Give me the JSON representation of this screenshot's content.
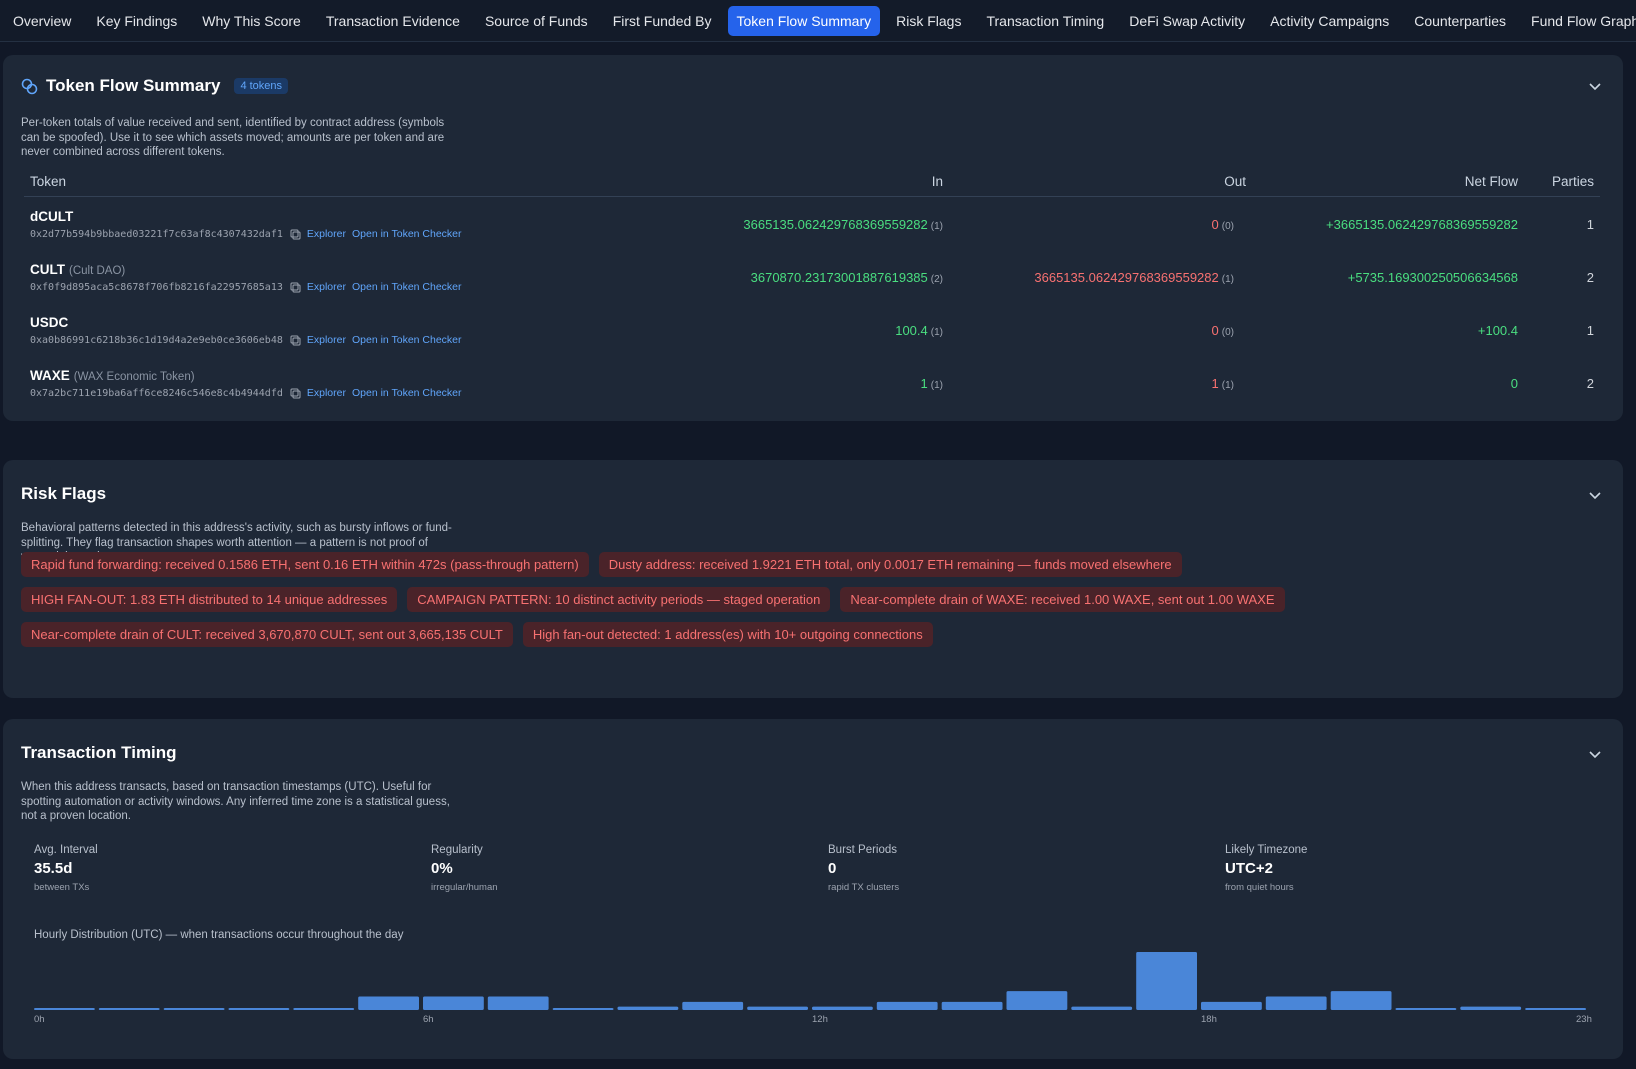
{
  "tabs": [
    {
      "label": "Overview",
      "active": false
    },
    {
      "label": "Key Findings",
      "active": false
    },
    {
      "label": "Why This Score",
      "active": false
    },
    {
      "label": "Transaction Evidence",
      "active": false
    },
    {
      "label": "Source of Funds",
      "active": false
    },
    {
      "label": "First Funded By",
      "active": false
    },
    {
      "label": "Token Flow Summary",
      "active": true
    },
    {
      "label": "Risk Flags",
      "active": false
    },
    {
      "label": "Transaction Timing",
      "active": false
    },
    {
      "label": "DeFi Swap Activity",
      "active": false
    },
    {
      "label": "Activity Campaigns",
      "active": false
    },
    {
      "label": "Counterparties",
      "active": false
    },
    {
      "label": "Fund Flow Graph",
      "active": false
    }
  ],
  "token_flow": {
    "title": "Token Flow Summary",
    "badge": "4 tokens",
    "description": "Per-token totals of value received and sent, identified by contract address (symbols can be spoofed). Use it to see which assets moved; amounts are per token and are never combined across different tokens.",
    "columns": {
      "token": "Token",
      "in": "In",
      "out": "Out",
      "net": "Net Flow",
      "parties": "Parties"
    },
    "explorer_label": "Explorer",
    "checker_label": "Open in Token Checker",
    "rows": [
      {
        "symbol": "dCULT",
        "name": "",
        "address": "0x2d77b594b9bbaed03221f7c63af8c4307432daf1",
        "in": "3665135.062429768369559282",
        "in_count": "(1)",
        "out": "0",
        "out_count": "(0)",
        "net": "+3665135.062429768369559282",
        "parties": "1"
      },
      {
        "symbol": "CULT",
        "name": "(Cult DAO)",
        "address": "0xf0f9d895aca5c8678f706fb8216fa22957685a13",
        "in": "3670870.23173001887619385",
        "in_count": "(2)",
        "out": "3665135.062429768369559282",
        "out_count": "(1)",
        "net": "+5735.16930025050663456‌8",
        "parties": "2"
      },
      {
        "symbol": "USDC",
        "name": "",
        "address": "0xa0b86991c6218b36c1d19d4a2e9eb0ce3606eb48",
        "in": "100.4",
        "in_count": "(1)",
        "out": "0",
        "out_count": "(0)",
        "net": "+100.4",
        "parties": "1"
      },
      {
        "symbol": "WAXE",
        "name": "(WAX Economic Token)",
        "address": "0x7a2bc711e19ba6aff6ce8246c546e8c4b4944dfd",
        "in": "1",
        "in_count": "(1)",
        "out": "1",
        "out_count": "(1)",
        "net": "0",
        "parties": "2"
      }
    ]
  },
  "risk_flags": {
    "title": "Risk Flags",
    "description": "Behavioral patterns detected in this address's activity, such as bursty inflows or fund-splitting. They flag transaction shapes worth attention — a pattern is not proof of wrongdoing or intent.",
    "rows": [
      [
        "Rapid fund forwarding: received 0.1586 ETH, sent 0.16 ETH within 472s (pass-through pattern)",
        "Dusty address: received 1.9221 ETH total, only 0.0017 ETH remaining — funds moved elsewhere"
      ],
      [
        "HIGH FAN-OUT: 1.83 ETH distributed to 14 unique addresses",
        "CAMPAIGN PATTERN: 10 distinct activity periods — staged operation",
        "Near-complete drain of WAXE: received 1.00 WAXE, sent out 1.00 WAXE"
      ],
      [
        "Near-complete drain of CULT: received 3,670,870 CULT, sent out 3,665,135 CULT",
        "High fan-out detected: 1 address(es) with 10+ outgoing connections"
      ]
    ]
  },
  "timing": {
    "title": "Transaction Timing",
    "description": "When this address transacts, based on transaction timestamps (UTC). Useful for spotting automation or activity windows. Any inferred time zone is a statistical guess, not a proven location.",
    "stats": [
      {
        "label": "Avg. Interval",
        "value": "35.5d",
        "sub": "between TXs"
      },
      {
        "label": "Regularity",
        "value": "0%",
        "sub": "irregular/human"
      },
      {
        "label": "Burst Periods",
        "value": "0",
        "sub": "rapid TX clusters"
      },
      {
        "label": "Likely Timezone",
        "value": "UTC+2",
        "sub": "from quiet hours"
      }
    ],
    "histogram_label": "Hourly Distribution (UTC) — when transactions occur throughout the day",
    "tick_labels": [
      "0h",
      "6h",
      "12h",
      "18h",
      "23h"
    ],
    "bar_color": "#4a86d8"
  },
  "chart_data": {
    "type": "bar",
    "categories": [
      "0",
      "1",
      "2",
      "3",
      "4",
      "5",
      "6",
      "7",
      "8",
      "9",
      "10",
      "11",
      "12",
      "13",
      "14",
      "15",
      "16",
      "17",
      "18",
      "19",
      "20",
      "21",
      "22",
      "23"
    ],
    "values": [
      0.1,
      0.1,
      0.1,
      0.1,
      0.1,
      1,
      1,
      1,
      0.1,
      0.25,
      0.6,
      0.25,
      0.25,
      0.6,
      0.6,
      1.4,
      0.25,
      4.3,
      0.6,
      1,
      1.4,
      0.1,
      0.25,
      0.1
    ],
    "xlabel": "",
    "ylabel": "",
    "tick_labels": [
      "0h",
      "6h",
      "12h",
      "18h",
      "23h"
    ]
  },
  "colors": {
    "accent": "#2563eb",
    "positive": "#4ade80",
    "negative": "#f87171",
    "link": "#60a5fa"
  }
}
